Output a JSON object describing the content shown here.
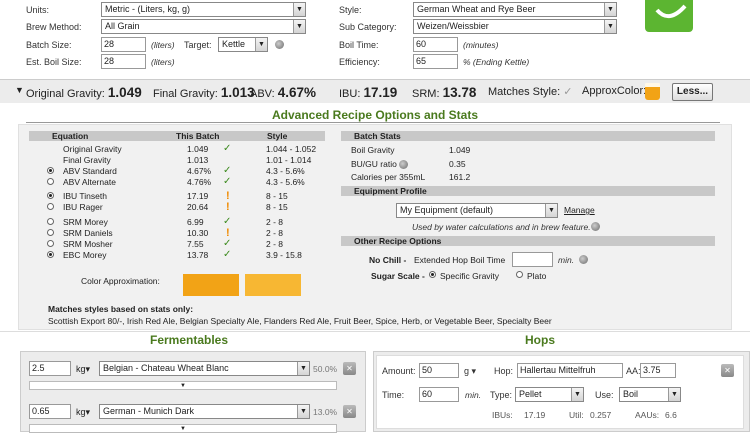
{
  "recipe": {
    "units_label": "Units:",
    "units_value": "Metric - (Liters, kg, g)",
    "brew_method_label": "Brew Method:",
    "brew_method_value": "All Grain",
    "batch_size_label": "Batch Size:",
    "batch_size_value": "28",
    "batch_unit": "(liters)",
    "target_label": "Target:",
    "target_value": "Kettle",
    "boil_size_label": "Est. Boil Size:",
    "boil_size_value": "28",
    "boil_unit": "(liters)",
    "style_label": "Style:",
    "style_value": "German Wheat and Rye Beer",
    "subcat_label": "Sub Category:",
    "subcat_value": "Weizen/Weissbier",
    "boil_time_label": "Boil Time:",
    "boil_time_value": "60",
    "boil_time_unit": "(minutes)",
    "efficiency_label": "Efficiency:",
    "efficiency_value": "65",
    "efficiency_unit": "% (Ending Kettle)"
  },
  "stats_bar": {
    "og_label": "Original Gravity:",
    "og": "1.049",
    "fg_label": "Final Gravity:",
    "fg": "1.013",
    "abv_label": "ABV:",
    "abv": "4.67%",
    "ibu_label": "IBU:",
    "ibu": "17.19",
    "srm_label": "SRM:",
    "srm": "13.78",
    "matches_label": "Matches Style:",
    "approx_color_label": "ApproxColor:",
    "less_button": "Less..."
  },
  "advanced": {
    "title": "Advanced Recipe Options and Stats",
    "table_headers": {
      "equation": "Equation",
      "batch": "This Batch",
      "style": "Style"
    },
    "rows": [
      {
        "label": "Original Gravity",
        "value": "1.049",
        "mark": "check",
        "range": "1.044 - 1.052",
        "radio": ""
      },
      {
        "label": "Final Gravity",
        "value": "1.013",
        "mark": "",
        "range": "1.01 - 1.014",
        "radio": ""
      },
      {
        "label": "ABV Standard",
        "value": "4.67%",
        "mark": "check",
        "range": "4.3 - 5.6%",
        "radio": "on"
      },
      {
        "label": "ABV Alternate",
        "value": "4.76%",
        "mark": "check",
        "range": "4.3 - 5.6%",
        "radio": "off"
      },
      {
        "label": "IBU Tinseth",
        "value": "17.19",
        "mark": "excl",
        "range": "8 - 15",
        "radio": "on"
      },
      {
        "label": "IBU Rager",
        "value": "20.64",
        "mark": "excl",
        "range": "8 - 15",
        "radio": "off"
      },
      {
        "label": "SRM Morey",
        "value": "6.99",
        "mark": "check",
        "range": "2 - 8",
        "radio": "off"
      },
      {
        "label": "SRM Daniels",
        "value": "10.30",
        "mark": "excl",
        "range": "2 - 8",
        "radio": "off"
      },
      {
        "label": "SRM Mosher",
        "value": "7.55",
        "mark": "check",
        "range": "2 - 8",
        "radio": "off"
      },
      {
        "label": "EBC Morey",
        "value": "13.78",
        "mark": "check",
        "range": "3.9 - 15.8",
        "radio": "on"
      }
    ],
    "color_approx_label": "Color Approximation:",
    "batch_color": "#f2a316",
    "style_color": "#f7b733",
    "matches_title": "Matches styles based on stats only:",
    "matches_text": "Scottish Export 80/-, Irish Red Ale, Belgian Specialty Ale, Flanders Red Ale, Fruit Beer, Spice, Herb, or Vegetable Beer, Specialty Beer",
    "batch_stats": {
      "header": "Batch Stats",
      "items": [
        {
          "label": "Boil Gravity",
          "value": "1.049"
        },
        {
          "label": "BU/GU ratio",
          "value": "0.35"
        },
        {
          "label": "Calories per 355mL",
          "value": "161.2"
        }
      ]
    },
    "equipment": {
      "header": "Equipment Profile",
      "selected": "My Equipment (default)",
      "manage": "Manage",
      "note": "Used by water calculations and in brew feature."
    },
    "other": {
      "header": "Other Recipe Options",
      "no_chill_label": "No Chill -",
      "extended_label": "Extended Hop Boil Time",
      "extended_unit": "min.",
      "sugar_label": "Sugar Scale -",
      "sg_label": "Specific Gravity",
      "plato_label": "Plato"
    }
  },
  "fermentables": {
    "title": "Fermentables",
    "items": [
      {
        "amount": "2.5",
        "unit": "kg",
        "name": "Belgian - Chateau Wheat Blanc",
        "pct": "50.0%"
      },
      {
        "amount": "0.65",
        "unit": "kg",
        "name": "German - Munich Dark",
        "pct": "13.0%"
      }
    ]
  },
  "hops": {
    "title": "Hops",
    "amount_label": "Amount:",
    "amount": "50",
    "amount_unit": "g",
    "hop_label": "Hop:",
    "hop": "Hallertau Mittelfruh",
    "aa_label": "AA:",
    "aa": "3.75",
    "time_label": "Time:",
    "time": "60",
    "time_unit": "min.",
    "type_label": "Type:",
    "type": "Pellet",
    "use_label": "Use:",
    "use": "Boil",
    "ibus_label": "IBUs:",
    "ibus": "17.19",
    "util_label": "Util:",
    "util": "0.257",
    "aaus_label": "AAUs:",
    "aaus": "6.6"
  }
}
